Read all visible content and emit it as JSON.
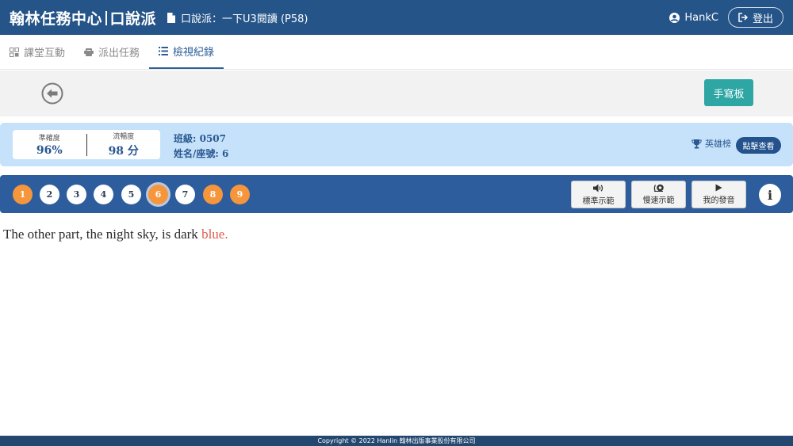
{
  "header": {
    "brand_left": "翰林任務中心",
    "brand_right": "口說派",
    "doc_title": "口說派：一下U3閱讀 (P58)",
    "user": "HankC",
    "logout_label": "登出"
  },
  "tabs": [
    {
      "label": "課堂互動",
      "icon": "grid-icon",
      "active": false
    },
    {
      "label": "派出任務",
      "icon": "dispatch-icon",
      "active": false
    },
    {
      "label": "檢視紀錄",
      "icon": "list-icon",
      "active": true
    }
  ],
  "toolbar": {
    "back_icon": "arrow-left-circle-icon",
    "handwriting_label": "手寫板"
  },
  "scores": {
    "accuracy_label": "準確度",
    "accuracy_value": "96%",
    "fluency_label": "流暢度",
    "fluency_value": "98 分",
    "class_line": "班級: 0507",
    "student_line": "姓名/座號: 6",
    "hero_label": "英雄榜",
    "view_label": "點擊查看"
  },
  "questions": {
    "items": [
      "1",
      "2",
      "3",
      "4",
      "5",
      "6",
      "7",
      "8",
      "9"
    ],
    "completed": [
      "1",
      "8",
      "9"
    ],
    "current": "6"
  },
  "controls": {
    "standard_label": "標準示範",
    "slow_label": "慢速示範",
    "mine_label": "我的發音",
    "info_label": "i"
  },
  "sentence": {
    "main": "The other part, the night sky, is dark",
    "highlight": "blue."
  },
  "footer": {
    "copyright": "Copyright © 2022 Hanlin 翰林出版事業股份有限公司"
  },
  "colors": {
    "header": "#245488",
    "accent": "#2d5e98",
    "orange": "#f5963c",
    "teal": "#2da6a4",
    "highlight": "#e05a4c"
  }
}
